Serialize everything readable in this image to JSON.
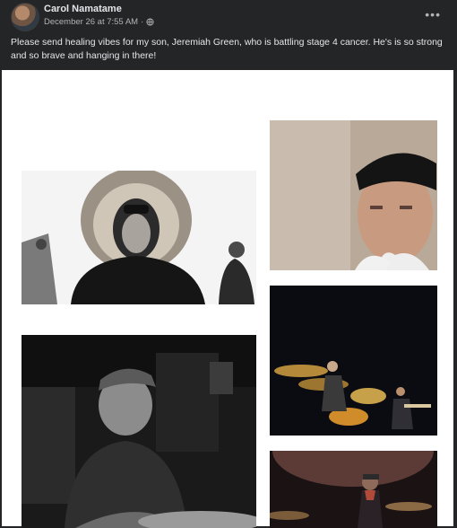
{
  "post": {
    "author": "Carol Namatame",
    "timestamp": "December 26 at 7:55 AM",
    "separator": "·",
    "privacy_icon": "globe-icon",
    "more_label": "•••",
    "caption": "Please send healing vibes for my son, Jeremiah Green, who is battling stage 4 cancer. He's is so strong and so brave and hanging in there!"
  },
  "colors": {
    "background": "#242526",
    "text_primary": "#e4e6eb",
    "text_secondary": "#b0b3b8",
    "media_background": "#ffffff"
  }
}
